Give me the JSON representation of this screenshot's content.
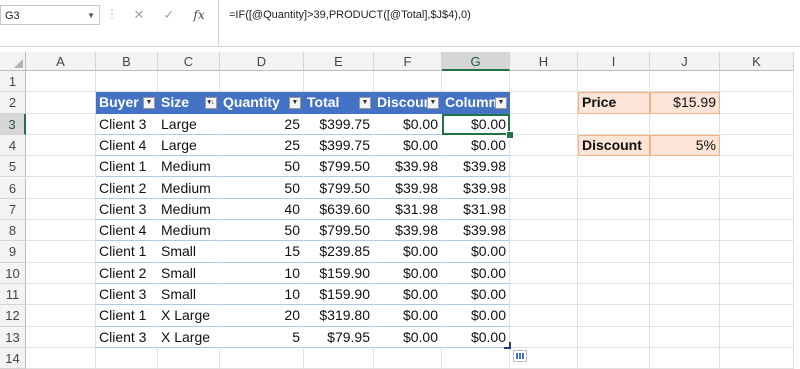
{
  "name_box": "G3",
  "formula": "=IF([@Quantity]>39,PRODUCT([@Total],$J$4),0)",
  "formula_buttons": {
    "cancel": "✕",
    "enter": "✓",
    "function": "fx"
  },
  "columns": [
    "A",
    "B",
    "C",
    "D",
    "E",
    "F",
    "G",
    "H",
    "I",
    "J",
    "K"
  ],
  "rows": [
    "1",
    "2",
    "3",
    "4",
    "5",
    "6",
    "7",
    "8",
    "9",
    "10",
    "11",
    "12",
    "13",
    "14"
  ],
  "selection": {
    "column": "G",
    "row": "3"
  },
  "table": {
    "headers": [
      "Buyer",
      "Size",
      "Quantity",
      "Total",
      "Discoun",
      "Column"
    ],
    "data": [
      [
        "Client 3",
        "Large",
        "25",
        "$399.75",
        "$0.00",
        "$0.00"
      ],
      [
        "Client 4",
        "Large",
        "25",
        "$399.75",
        "$0.00",
        "$0.00"
      ],
      [
        "Client 1",
        "Medium",
        "50",
        "$799.50",
        "$39.98",
        "$39.98"
      ],
      [
        "Client 2",
        "Medium",
        "50",
        "$799.50",
        "$39.98",
        "$39.98"
      ],
      [
        "Client 3",
        "Medium",
        "40",
        "$639.60",
        "$31.98",
        "$31.98"
      ],
      [
        "Client 4",
        "Medium",
        "50",
        "$799.50",
        "$39.98",
        "$39.98"
      ],
      [
        "Client 1",
        "Small",
        "15",
        "$239.85",
        "$0.00",
        "$0.00"
      ],
      [
        "Client 2",
        "Small",
        "10",
        "$159.90",
        "$0.00",
        "$0.00"
      ],
      [
        "Client 3",
        "Small",
        "10",
        "$159.90",
        "$0.00",
        "$0.00"
      ],
      [
        "Client 1",
        "X Large",
        "20",
        "$319.80",
        "$0.00",
        "$0.00"
      ],
      [
        "Client 3",
        "X Large",
        "5",
        "$79.95",
        "$0.00",
        "$0.00"
      ]
    ]
  },
  "side": {
    "price_label": "Price",
    "price_value": "$15.99",
    "discount_label": "Discount",
    "discount_value": "5%"
  },
  "colors": {
    "table_header": "#4472c4",
    "selection": "#217346",
    "param_fill": "#fce4d6"
  }
}
